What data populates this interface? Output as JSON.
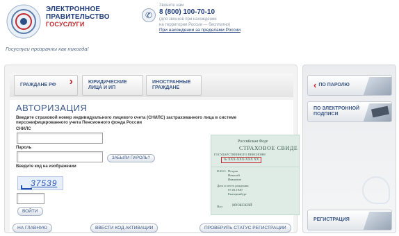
{
  "header": {
    "logo_line1": "ЭЛЕКТРОННОЕ",
    "logo_line2": "ПРАВИТЕЛЬСТВО",
    "logo_line3": "ГОСУСЛУГИ",
    "slogan": "Госуслуги прозрачны как никогда!",
    "phone_caption": "Звоните нам",
    "phone_number": "8 (800) 100-70-10",
    "phone_note1": "(для звонков при нахождении",
    "phone_note2": "на территории России — бесплатно)",
    "phone_abroad_link": "При нахождении за пределами России"
  },
  "tabs": [
    {
      "label_line1": "ГРАЖДАНЕ РФ",
      "label_line2": ""
    },
    {
      "label_line1": "ЮРИДИЧЕСКИЕ",
      "label_line2": "ЛИЦА И ИП"
    },
    {
      "label_line1": "ИНОСТРАННЫЕ",
      "label_line2": "ГРАЖДАНЕ"
    }
  ],
  "auth": {
    "title": "АВТОРИЗАЦИЯ",
    "description": "Введите страховой номер индивидуального лицевого счета (СНИЛС) застрахованного лица в системе персонифицированного учета Пенсионного фонда России",
    "snils_label": "СНИЛС",
    "snils_value": "",
    "password_label": "Пароль",
    "password_value": "",
    "forgot_password": "ЗАБЫЛИ ПАРОЛЬ?",
    "captcha_label": "Введите код на изображении",
    "captcha_text": "37539",
    "captcha_value": "",
    "login_button": "ВОЙТИ"
  },
  "snils_card": {
    "line1": "Российская Феде",
    "line2": "СТРАХОВОЕ СВИДЕ",
    "line3": "ГОСУДАРСТВЕННОГО ПЕНСИОНН",
    "number": "№ XXX-XXX-XXX XX",
    "fio_label": "Ф.И.О.",
    "surname": "Петров",
    "name": "Николай",
    "patronymic": "Иванович",
    "birth_label1": "Дата и место рождения",
    "birth_date": "07.03.1949",
    "birth_place": "Екатеринбург",
    "sex_label": "Пол",
    "sex": "МУЖСКОЙ"
  },
  "bottom_links": {
    "home": "НА ГЛАВНУЮ",
    "activation": "ВВЕСТИ КОД АКТИВАЦИИ",
    "status": "ПРОВЕРИТЬ СТАТУС РЕГИСТРАЦИИ"
  },
  "sidebar": {
    "by_password": "ПО ПАРОЛЮ",
    "by_signature_line1": "ПО ЭЛЕКТРОННОЙ",
    "by_signature_line2": "ПОДПИСИ",
    "registration": "РЕГИСТРАЦИЯ"
  },
  "colors": {
    "brand_blue": "#1e3d7a",
    "accent_red": "#c0272d",
    "link_blue": "#3a5788"
  }
}
